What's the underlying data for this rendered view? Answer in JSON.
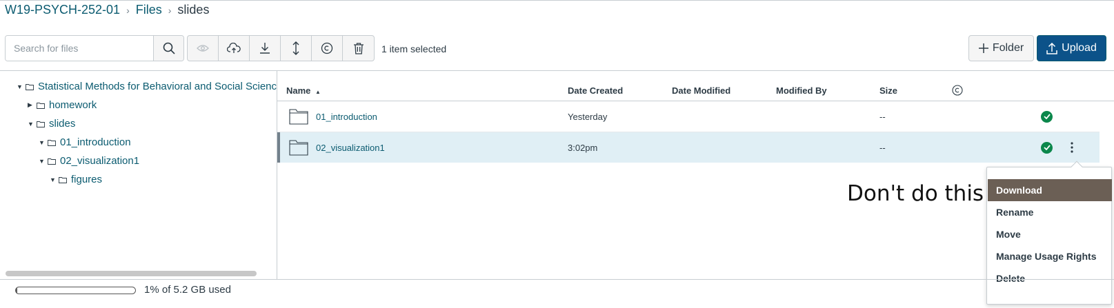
{
  "breadcrumb": {
    "course": "W19-PSYCH-252-01",
    "files": "Files",
    "current": "slides"
  },
  "search": {
    "placeholder": "Search for files",
    "value": ""
  },
  "toolbar": {
    "buttons": [
      "eye-icon",
      "cloud-upload-icon",
      "download-icon",
      "move-icon",
      "copyright-icon",
      "trash-icon"
    ],
    "selected_text": "1 item selected",
    "folder_label": "Folder",
    "upload_label": "Upload"
  },
  "tree": {
    "root": "Statistical Methods for Behavioral and Social Sciences",
    "items": [
      {
        "label": "homework",
        "expanded": false
      },
      {
        "label": "slides",
        "expanded": true
      },
      {
        "label": "01_introduction",
        "expanded": true
      },
      {
        "label": "02_visualization1",
        "expanded": true
      },
      {
        "label": "figures",
        "expanded": true
      }
    ]
  },
  "table": {
    "headers": {
      "name": "Name",
      "sort": "▲",
      "created": "Date Created",
      "modified": "Date Modified",
      "modified_by": "Modified By",
      "size": "Size"
    },
    "rows": [
      {
        "name": "01_introduction",
        "created": "Yesterday",
        "modified": "",
        "modified_by": "",
        "size": "--",
        "published": true,
        "selected": false
      },
      {
        "name": "02_visualization1",
        "created": "3:02pm",
        "modified": "",
        "modified_by": "",
        "size": "--",
        "published": true,
        "selected": true
      }
    ]
  },
  "annotation": "Don't do this",
  "menu": {
    "items": [
      "Download",
      "Rename",
      "Move",
      "Manage Usage Rights",
      "Delete"
    ],
    "active": "Download"
  },
  "quota": {
    "text": "1% of 5.2 GB used",
    "fraction": 0.01
  },
  "colors": {
    "link": "#0b5b70",
    "upload_bg": "#0c5289",
    "published": "#0b874b",
    "selected_row": "#e0eff5",
    "menu_active": "#6b5f55"
  }
}
